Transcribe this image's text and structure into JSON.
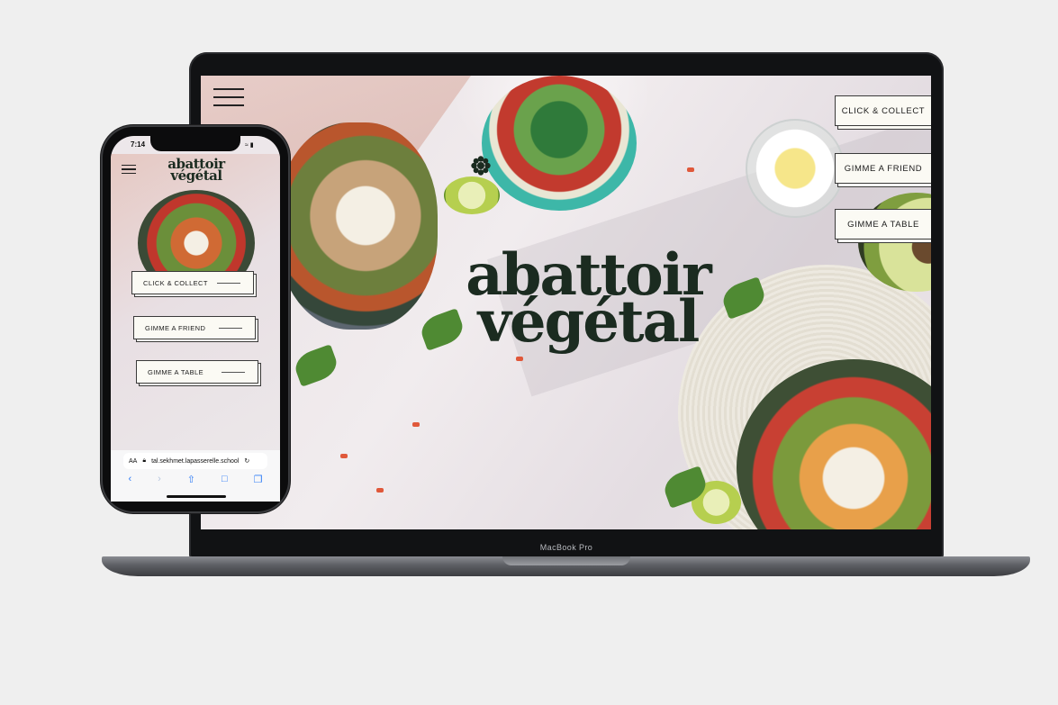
{
  "laptop": {
    "brand_label": "MacBook Pro",
    "logo": {
      "line1": "abattoir",
      "line2": "végétal"
    },
    "menu_buttons": [
      {
        "label": "CLICK & COLLECT"
      },
      {
        "label": "GIMME A FRIEND"
      },
      {
        "label": "GIMME A TABLE"
      }
    ],
    "icons": {
      "menu": "hamburger-icon",
      "logo_mark": "flower-icon"
    }
  },
  "phone": {
    "status": {
      "time": "7:14"
    },
    "logo": {
      "line1": "abattoir",
      "line2": "végétal"
    },
    "menu_buttons": [
      {
        "label": "CLICK & COLLECT"
      },
      {
        "label": "GIMME A FRIEND"
      },
      {
        "label": "GIMME A TABLE"
      }
    ],
    "browser": {
      "text_size_label": "AA",
      "url": "tal.sekhmet.lapasserelle.school"
    },
    "icons": {
      "menu": "hamburger-icon",
      "lock": "lock-icon",
      "reload": "reload-icon"
    }
  },
  "colors": {
    "logo": "#1b2b20",
    "button_bg": "#fbfaf4",
    "safari_blue": "#2f7cf6"
  }
}
